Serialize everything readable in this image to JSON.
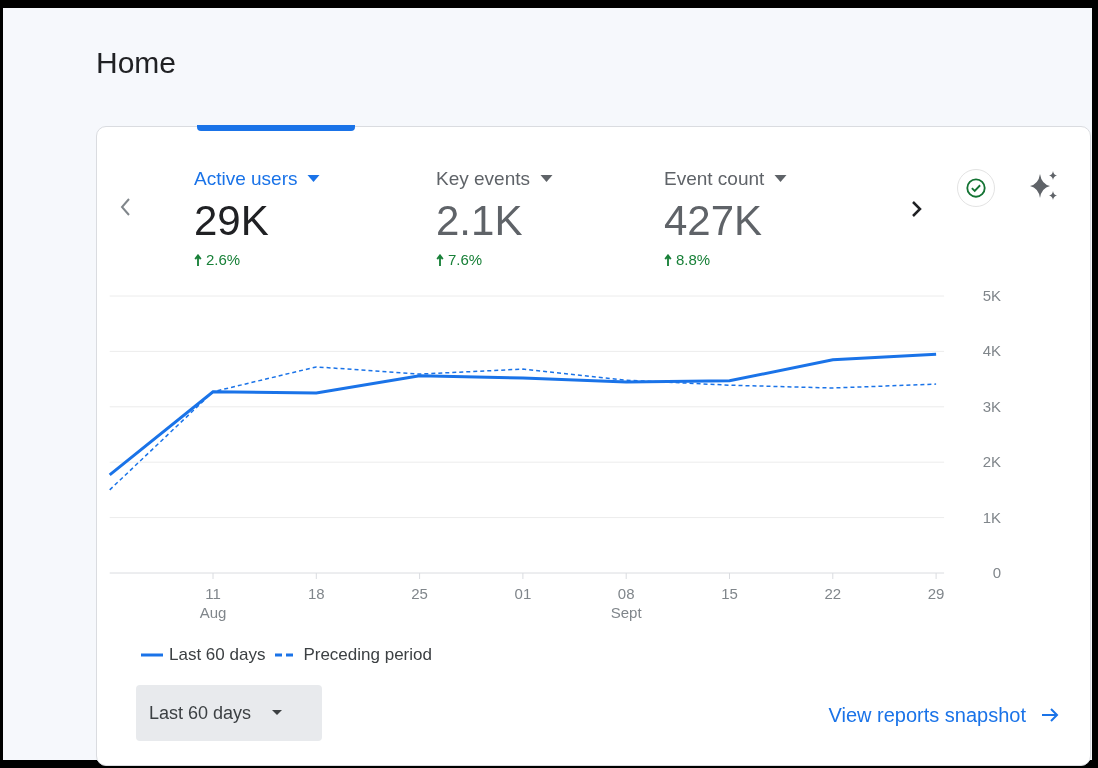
{
  "page": {
    "title": "Home"
  },
  "metrics": [
    {
      "label": "Active users",
      "value": "29K",
      "change": "2.6%",
      "selected": true
    },
    {
      "label": "Key events",
      "value": "2.1K",
      "change": "7.6%",
      "selected": false
    },
    {
      "label": "Event count",
      "value": "427K",
      "change": "8.8%",
      "selected": false
    }
  ],
  "chart_data": {
    "type": "line",
    "grid": true,
    "categories": [
      null,
      "11 Aug",
      "18",
      "25",
      "01",
      "08 Sept",
      "15",
      "22",
      "29"
    ],
    "series": [
      {
        "name": "Last 60 days",
        "color": "#1a73e8",
        "line_style": "solid",
        "values": [
          1.77,
          3.27,
          3.25,
          3.56,
          3.52,
          3.45,
          3.47,
          3.85,
          3.95
        ]
      },
      {
        "name": "Preceding period",
        "color": "#1a73e8",
        "line_style": "dashed",
        "values": [
          1.5,
          3.27,
          3.72,
          3.59,
          3.68,
          3.48,
          3.39,
          3.34,
          3.41
        ]
      }
    ],
    "ylim": [
      0,
      5
    ],
    "yticks": [
      {
        "value": 0,
        "label": "0"
      },
      {
        "value": 1,
        "label": "1K"
      },
      {
        "value": 2,
        "label": "2K"
      },
      {
        "value": 3,
        "label": "3K"
      },
      {
        "value": 4,
        "label": "4K"
      },
      {
        "value": 5,
        "label": "5K"
      }
    ]
  },
  "date_range": {
    "value": "Last 60 days"
  },
  "link": {
    "label": "View reports snapshot"
  }
}
